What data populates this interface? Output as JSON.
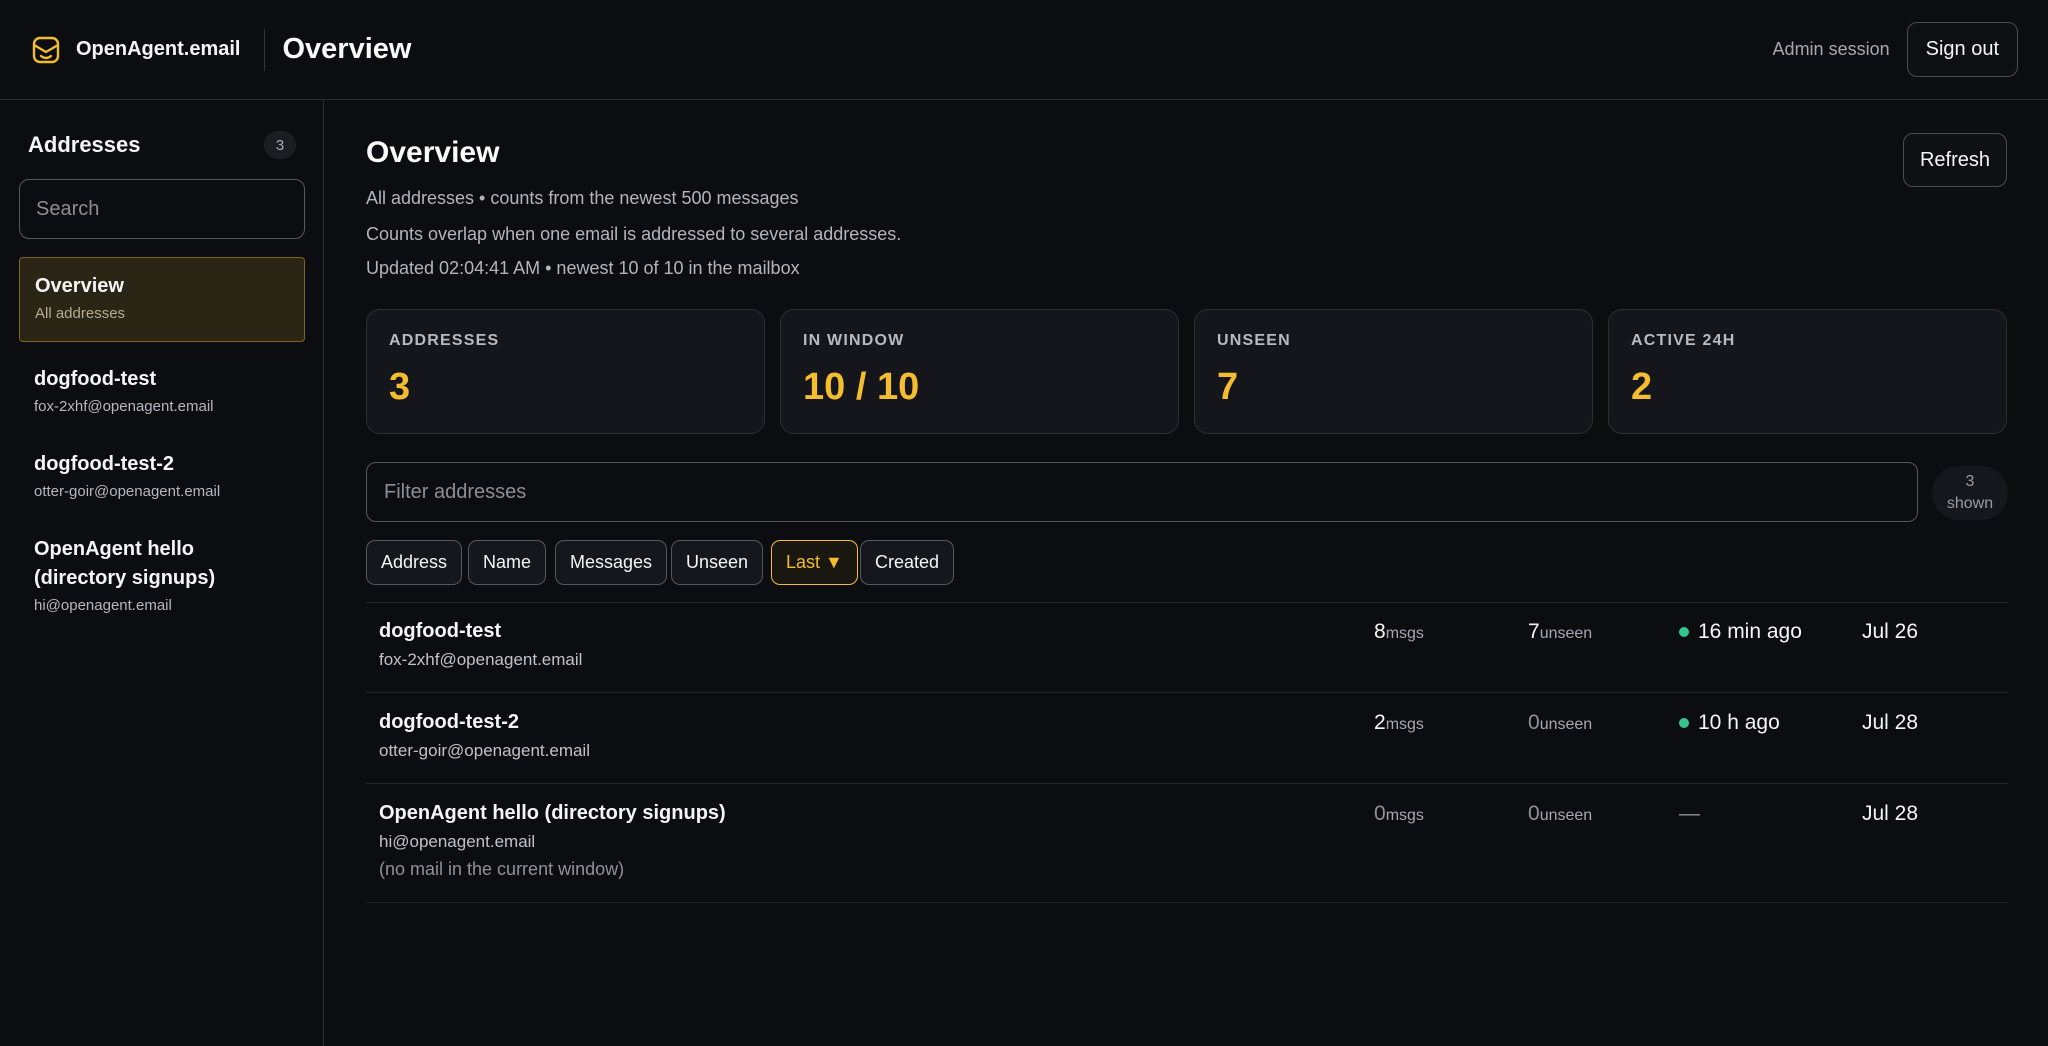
{
  "header": {
    "brand": "OpenAgent.email",
    "title": "Overview",
    "session_label": "Admin session",
    "signout_label": "Sign out",
    "accent": "#f4bd2e"
  },
  "sidebar": {
    "title": "Addresses",
    "count": "3",
    "search_placeholder": "Search",
    "items": [
      {
        "name": "Overview",
        "sub": "All addresses",
        "active": true
      },
      {
        "name": "dogfood-test",
        "sub": "fox-2xhf@openagent.email"
      },
      {
        "name": "dogfood-test-2",
        "sub": "otter-goir@openagent.email"
      },
      {
        "name_line1": "OpenAgent hello",
        "name_line2": "(directory signups)",
        "sub": "hi@openagent.email"
      }
    ]
  },
  "main": {
    "title": "Overview",
    "refresh_label": "Refresh",
    "subtitle": "All addresses • counts from the newest 500 messages",
    "note": "Counts overlap when one email is addressed to several addresses.",
    "updated": "Updated 02:04:41 AM • newest 10 of 10 in the mailbox",
    "stats": [
      {
        "label": "ADDRESSES",
        "value": "3"
      },
      {
        "label": "IN WINDOW",
        "value": "10 / 10"
      },
      {
        "label": "UNSEEN",
        "value": "7"
      },
      {
        "label": "ACTIVE 24H",
        "value": "2"
      }
    ],
    "filter_placeholder": "Filter addresses",
    "shown": {
      "count": "3",
      "label": "shown"
    },
    "sort_buttons": [
      "Address",
      "Name",
      "Messages",
      "Unseen",
      "Last ▼",
      "Created"
    ],
    "active_sort": "Last ▼",
    "rows": [
      {
        "name": "dogfood-test",
        "email": "fox-2xhf@openagent.email",
        "msgs": "8",
        "msgs_unit": "msgs",
        "unseen": "7",
        "unseen_unit": "unseen",
        "last": "16 min ago",
        "created": "Jul 26"
      },
      {
        "name": "dogfood-test-2",
        "email": "otter-goir@openagent.email",
        "msgs": "2",
        "msgs_unit": "msgs",
        "unseen": "0",
        "unseen_unit": "unseen",
        "last": "10 h ago",
        "created": "Jul 28"
      },
      {
        "name": "OpenAgent hello (directory signups)",
        "email": "hi@openagent.email",
        "note": "(no mail in the current window)",
        "msgs": "0",
        "msgs_unit": "msgs",
        "unseen": "0",
        "unseen_unit": "unseen",
        "last": "—",
        "created": "Jul 28"
      }
    ],
    "status_color": "#34c58d"
  }
}
